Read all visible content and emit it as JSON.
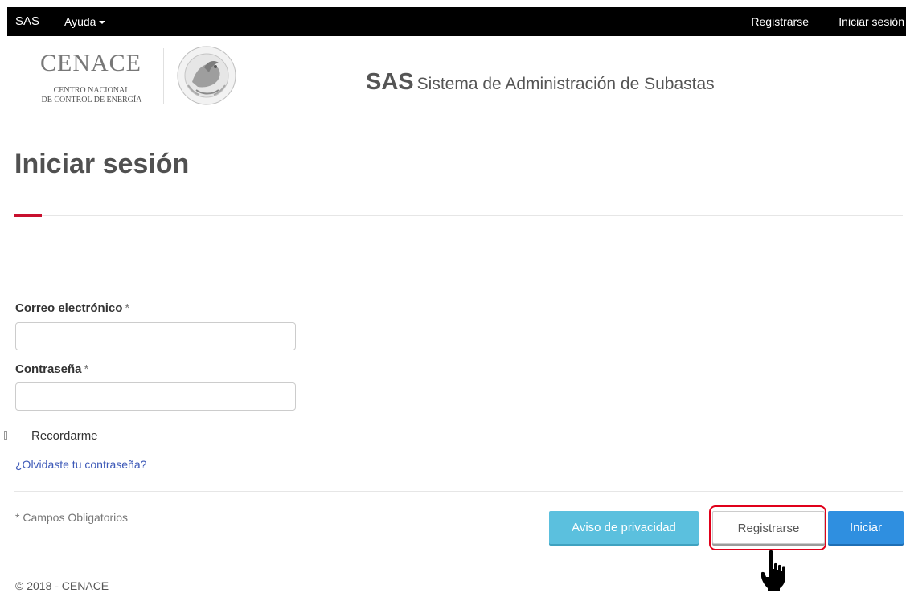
{
  "navbar": {
    "brand": "SAS",
    "help": "Ayuda",
    "register": "Registrarse",
    "login": "Iniciar sesión"
  },
  "header": {
    "logo_cenace": "CENACE",
    "logo_line1": "CENTRO NACIONAL",
    "logo_line2": "DE CONTROL DE ENERGÍA",
    "seal_text": "ESTADOS UNIDOS MEXICANOS",
    "app_abbr": "SAS",
    "app_name": "Sistema de Administración de Subastas"
  },
  "page": {
    "title": "Iniciar sesión"
  },
  "form": {
    "email_label": "Correo electrónico",
    "password_label": "Contraseña",
    "required_mark": "*",
    "email_value": "",
    "password_value": "",
    "remember_label": "Recordarme",
    "remember_checked": false,
    "forgot_link": "¿Olvidaste tu contraseña?",
    "required_note": "* Campos Obligatorios"
  },
  "buttons": {
    "privacy": "Aviso de privacidad",
    "register": "Registrarse",
    "login": "Iniciar"
  },
  "annotation": {
    "highlight_color": "#e0001a",
    "highlighted_target": "Registrarse"
  },
  "colors": {
    "navbar_bg": "#000000",
    "accent_red": "#c8102e",
    "privacy_button": "#5bc0de",
    "login_button": "#2f8fe0",
    "link": "#3e5ab8"
  },
  "footer": {
    "copyright": "© 2018 - CENACE"
  }
}
